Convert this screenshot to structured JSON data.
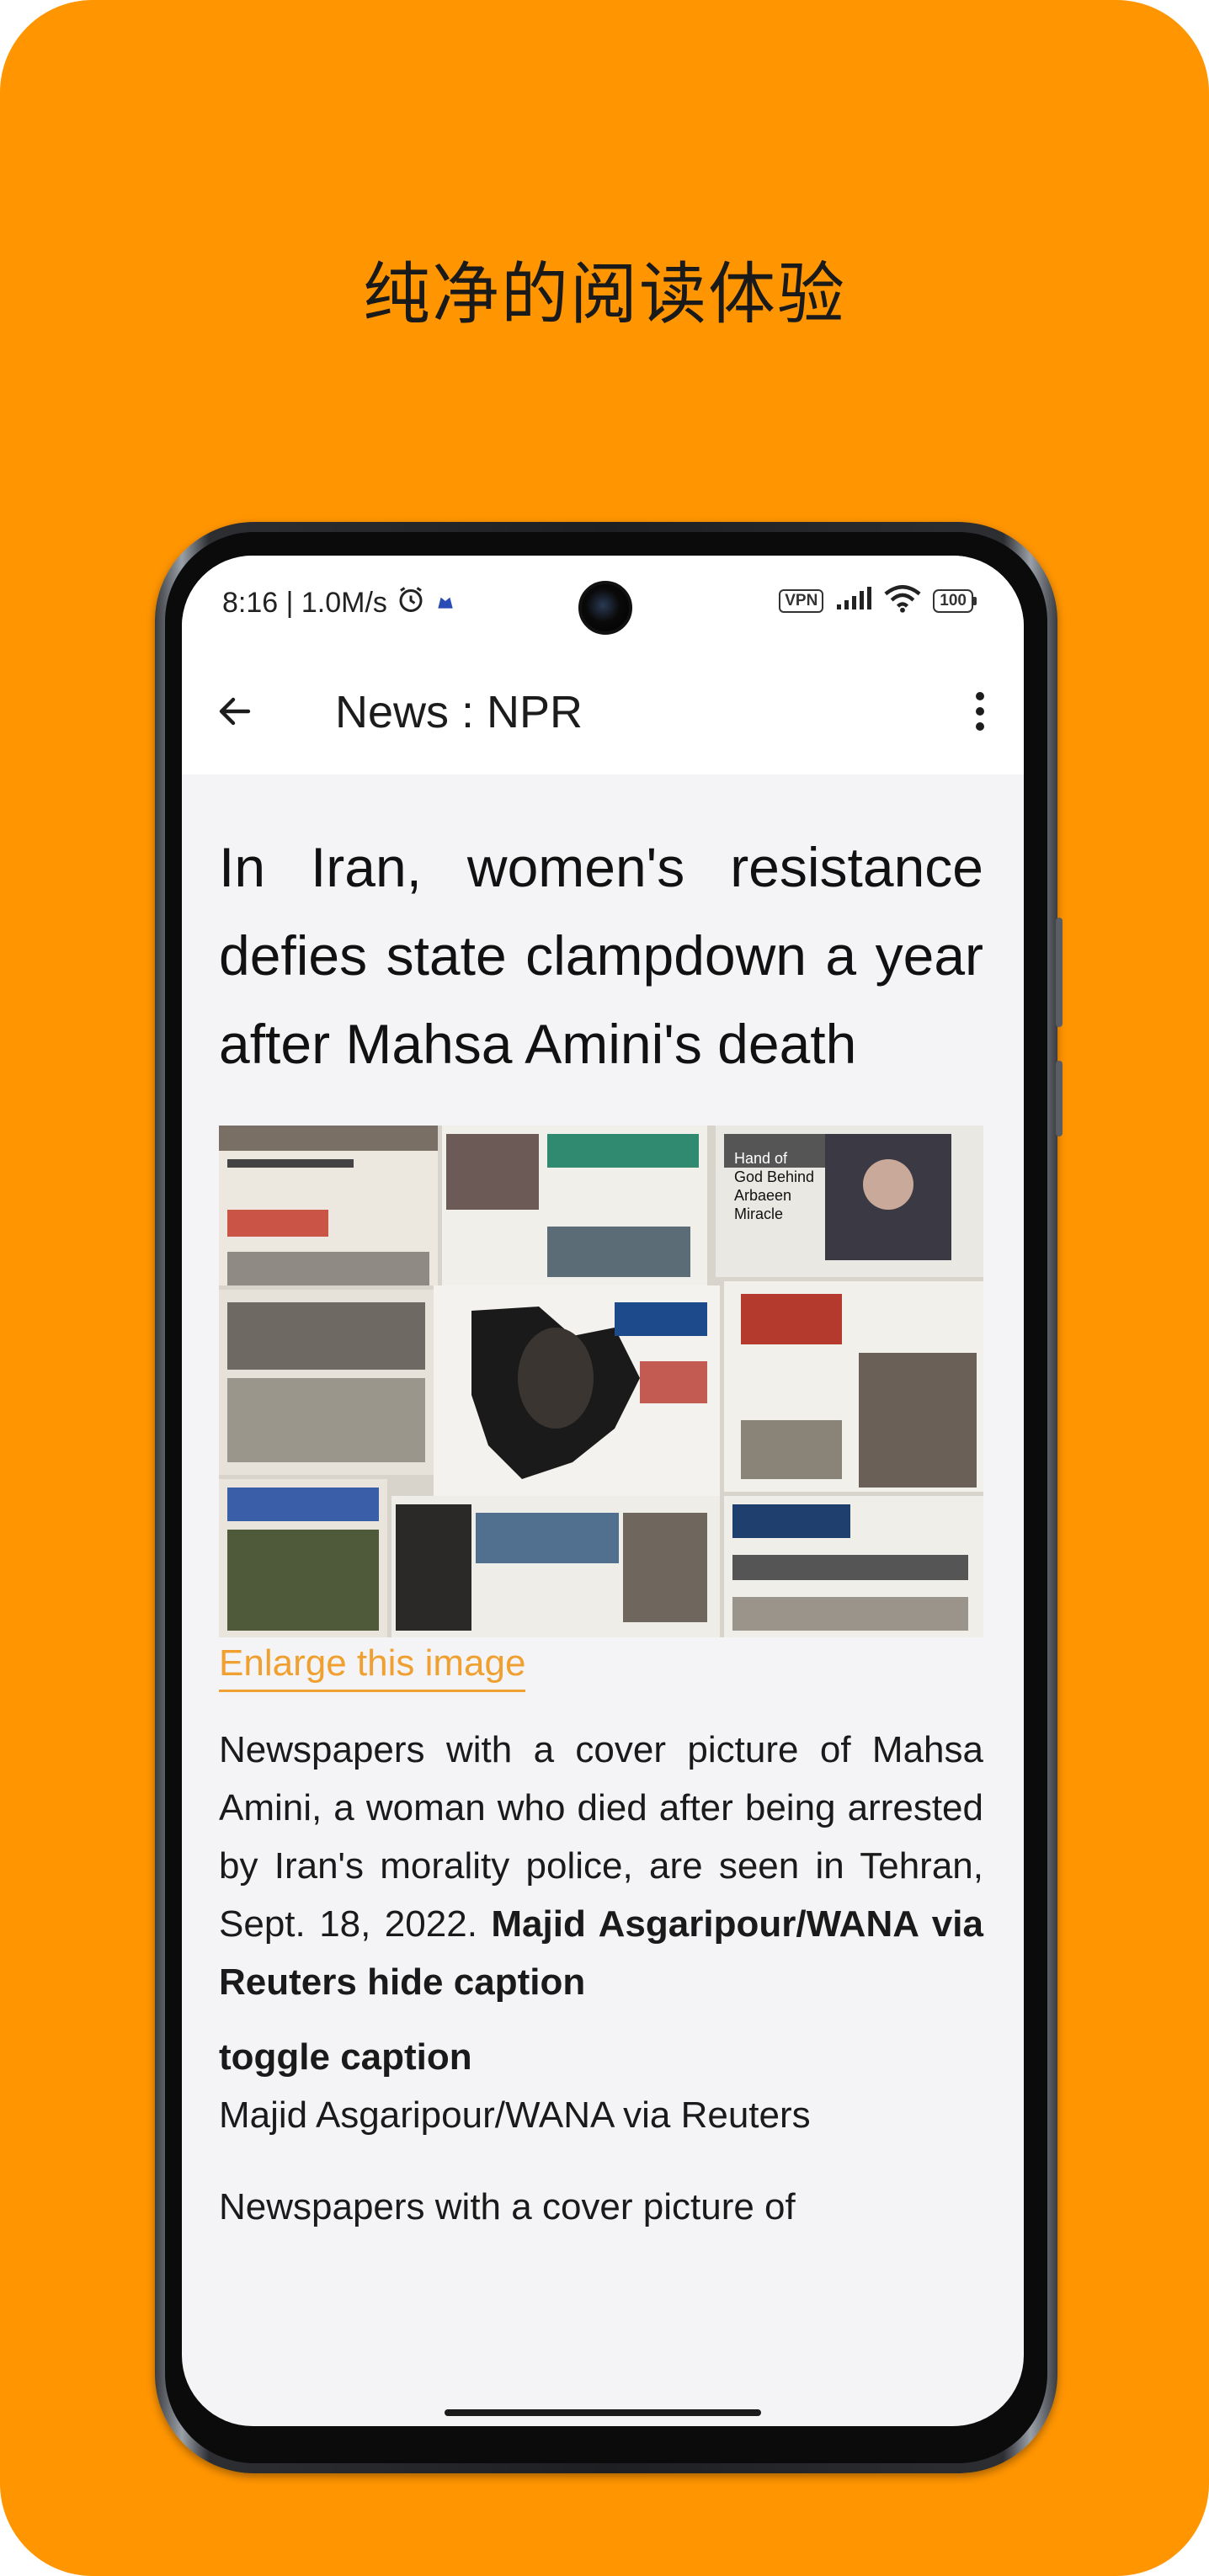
{
  "promo": {
    "title": "纯净的阅读体验"
  },
  "status_bar": {
    "time_speed": "8:16 | 1.0M/s",
    "vpn_label": "VPN",
    "battery_level": "100"
  },
  "app_bar": {
    "title": "News : NPR"
  },
  "article": {
    "headline": "In Iran, women's resistance defies state clampdown a year after Mahsa Amini's death",
    "image_alt": "Newspapers with a cover picture of Mahsa Amini",
    "image_texts": {
      "hand_of_god": "Hand of God Behind Arbaeen Miracle"
    },
    "enlarge_link": "Enlarge this image",
    "caption": "Newspapers with a cover picture of Mahsa Amini, a woman who died after being arrested by Iran's morality police, are seen in Tehran, Sept. 18, 2022.",
    "caption_credit_inline": "Majid Asgaripour/WANA via Reuters",
    "hide_caption": "hide caption",
    "toggle_caption": "toggle caption",
    "credit": "Majid Asgaripour/WANA via Reuters",
    "body_start": "Newspapers with a cover picture of"
  },
  "colors": {
    "promo_background": "#FF9500",
    "link_accent": "#F0A030",
    "screen_background": "#f4f4f6"
  },
  "icons": {
    "back": "arrow-left-icon",
    "menu": "more-vertical-icon",
    "alarm": "alarm-icon",
    "wifi": "wifi-icon",
    "signal": "signal-icon",
    "battery": "battery-icon"
  }
}
